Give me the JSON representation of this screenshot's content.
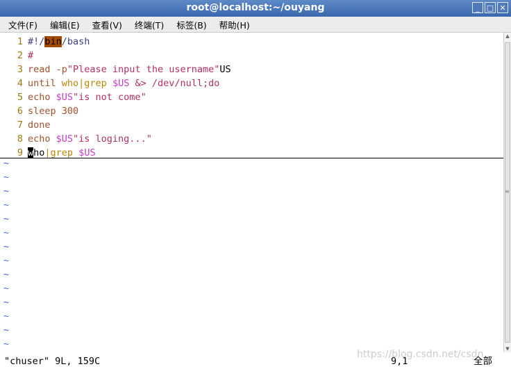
{
  "window": {
    "title": "root@localhost:~/ouyang",
    "buttons": [
      "_",
      "□",
      "✕"
    ]
  },
  "menu": [
    "文件(F)",
    "编辑(E)",
    "查看(V)",
    "终端(T)",
    "标签(B)",
    "帮助(H)"
  ],
  "colors": {
    "linenumber": "#9a7a10",
    "keyword": "#a0522d",
    "string": "#b03060",
    "variable": "#c040c0",
    "command": "#b8860b",
    "operator": "#b8860b",
    "path": "#404080",
    "tilde": "#4a6fc8",
    "highlight": "#a64c00"
  },
  "lines": [
    {
      "num": "1",
      "tokens": [
        {
          "t": "#!/",
          "c": "path"
        },
        {
          "t": "bin",
          "c": "hl"
        },
        {
          "t": "/bash",
          "c": "path"
        }
      ]
    },
    {
      "num": "2",
      "tokens": [
        {
          "t": "#",
          "c": "string"
        }
      ]
    },
    {
      "num": "3",
      "tokens": [
        {
          "t": "read",
          "c": "keyword"
        },
        {
          "t": " -p",
          "c": "keyword"
        },
        {
          "t": "\"Please input the username\"",
          "c": "string"
        },
        {
          "t": "US",
          "c": "plain"
        }
      ]
    },
    {
      "num": "4",
      "tokens": [
        {
          "t": "until",
          "c": "keyword"
        },
        {
          "t": " who",
          "c": "command"
        },
        {
          "t": "|",
          "c": "operator"
        },
        {
          "t": "grep",
          "c": "command"
        },
        {
          "t": " $US",
          "c": "variable"
        },
        {
          "t": " &> /dev/null;do",
          "c": "string"
        }
      ]
    },
    {
      "num": "5",
      "tokens": [
        {
          "t": "echo",
          "c": "keyword"
        },
        {
          "t": " $US",
          "c": "variable"
        },
        {
          "t": "\"is not come\"",
          "c": "string"
        }
      ]
    },
    {
      "num": "6",
      "tokens": [
        {
          "t": "sleep",
          "c": "keyword"
        },
        {
          "t": " 300",
          "c": "keyword"
        }
      ]
    },
    {
      "num": "7",
      "tokens": [
        {
          "t": "done",
          "c": "keyword"
        }
      ]
    },
    {
      "num": "8",
      "tokens": [
        {
          "t": "echo",
          "c": "keyword"
        },
        {
          "t": " $US",
          "c": "variable"
        },
        {
          "t": "\"is loging...\"",
          "c": "string"
        }
      ]
    },
    {
      "num": "9",
      "tokens": [
        {
          "t": "w",
          "c": "cursor"
        },
        {
          "t": "ho",
          "c": "plain"
        },
        {
          "t": "|",
          "c": "operator"
        },
        {
          "t": "grep",
          "c": "command"
        },
        {
          "t": " $US",
          "c": "variable"
        }
      ]
    }
  ],
  "tilde_char": "~",
  "tilde_count": 14,
  "status": {
    "file": "\"chuser\" 9L, 159C",
    "position": "9,1",
    "all": "全部"
  },
  "watermark": "https://blog.csdn.net/csdn..."
}
